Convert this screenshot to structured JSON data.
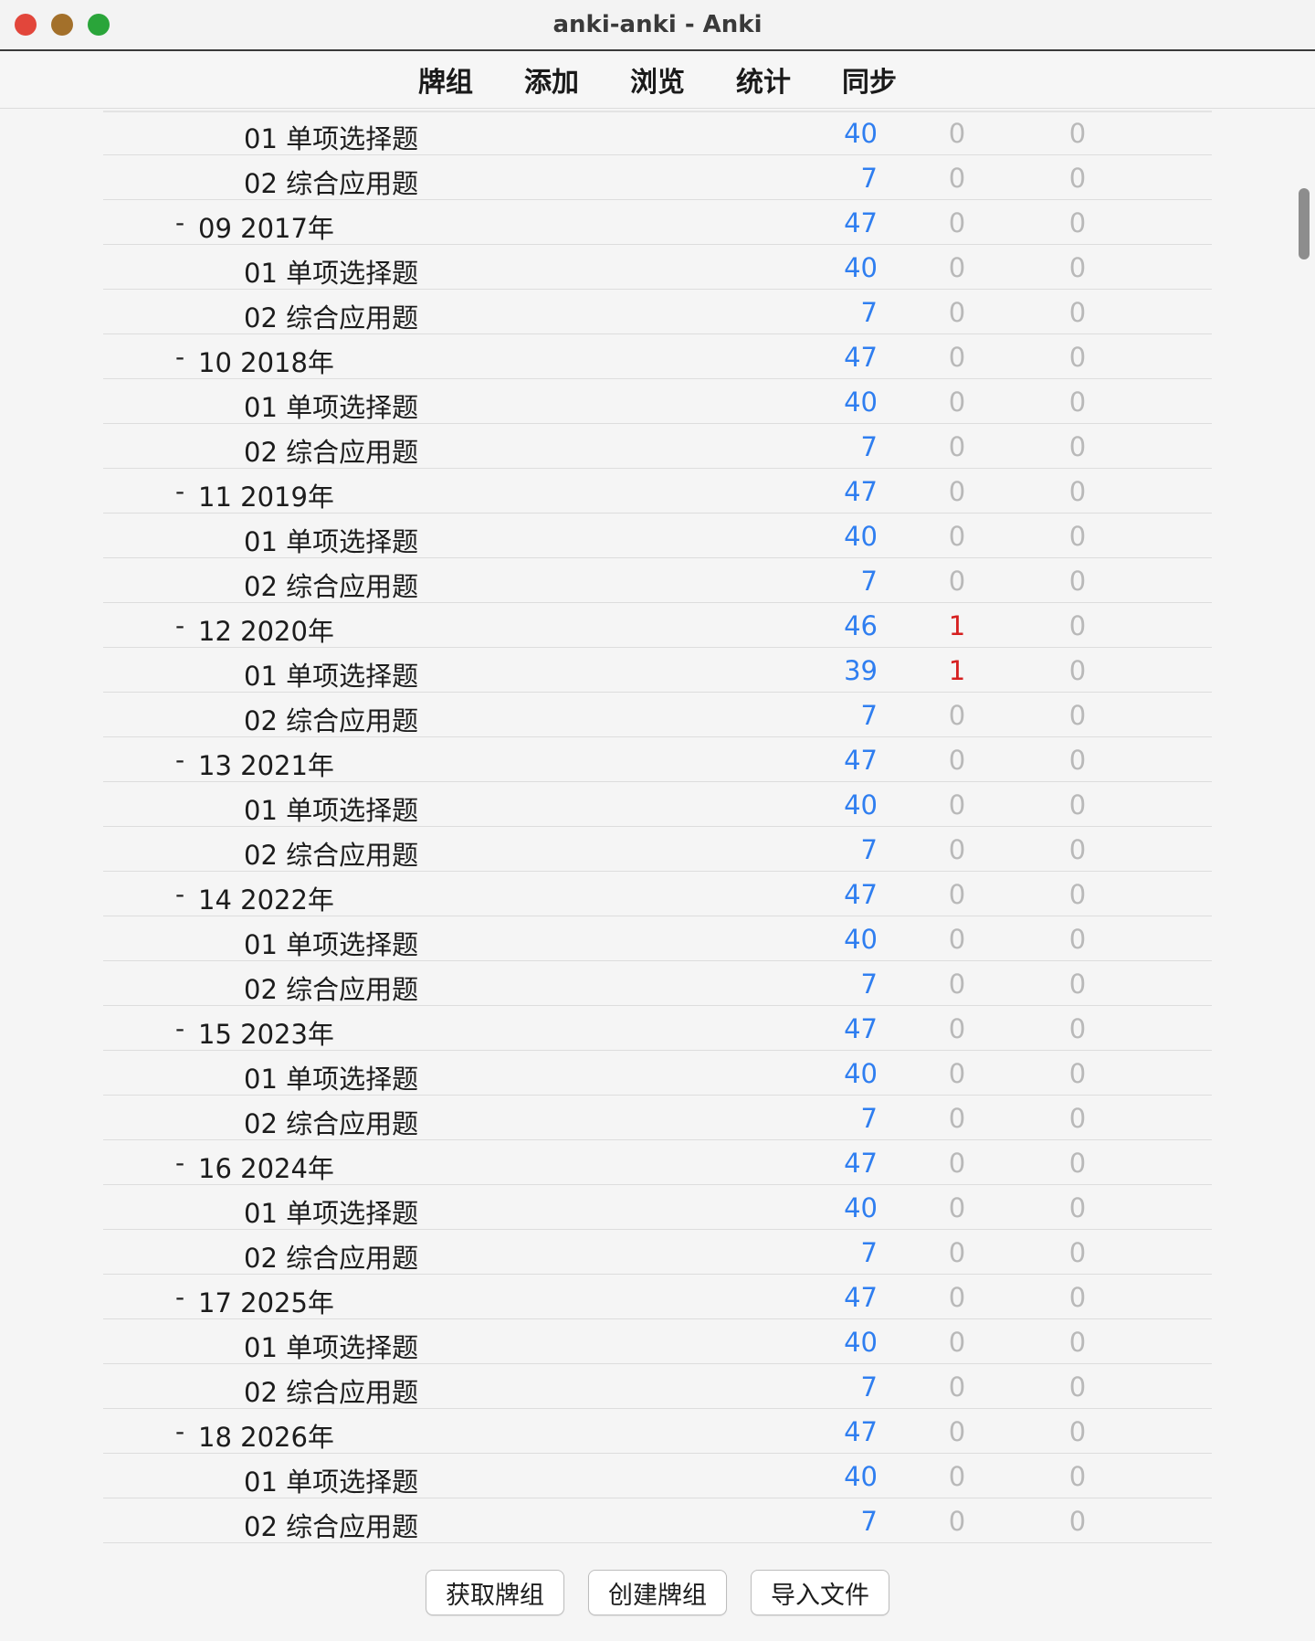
{
  "window": {
    "title": "anki-anki - Anki"
  },
  "toolbar": {
    "tabs": [
      "牌组",
      "添加",
      "浏览",
      "统计",
      "同步"
    ]
  },
  "decks": [
    {
      "level": "child",
      "toggle": "",
      "name": "01 单项选择题",
      "new": "40",
      "learn": "0",
      "review": "0"
    },
    {
      "level": "child",
      "toggle": "",
      "name": "02 综合应用题",
      "new": "7",
      "learn": "0",
      "review": "0"
    },
    {
      "level": "parent",
      "toggle": "-",
      "name": "09 2017年",
      "new": "47",
      "learn": "0",
      "review": "0"
    },
    {
      "level": "child",
      "toggle": "",
      "name": "01 单项选择题",
      "new": "40",
      "learn": "0",
      "review": "0"
    },
    {
      "level": "child",
      "toggle": "",
      "name": "02 综合应用题",
      "new": "7",
      "learn": "0",
      "review": "0"
    },
    {
      "level": "parent",
      "toggle": "-",
      "name": "10 2018年",
      "new": "47",
      "learn": "0",
      "review": "0"
    },
    {
      "level": "child",
      "toggle": "",
      "name": "01 单项选择题",
      "new": "40",
      "learn": "0",
      "review": "0"
    },
    {
      "level": "child",
      "toggle": "",
      "name": "02 综合应用题",
      "new": "7",
      "learn": "0",
      "review": "0"
    },
    {
      "level": "parent",
      "toggle": "-",
      "name": "11 2019年",
      "new": "47",
      "learn": "0",
      "review": "0"
    },
    {
      "level": "child",
      "toggle": "",
      "name": "01 单项选择题",
      "new": "40",
      "learn": "0",
      "review": "0"
    },
    {
      "level": "child",
      "toggle": "",
      "name": "02 综合应用题",
      "new": "7",
      "learn": "0",
      "review": "0"
    },
    {
      "level": "parent",
      "toggle": "-",
      "name": "12 2020年",
      "new": "46",
      "learn": "1",
      "review": "0"
    },
    {
      "level": "child",
      "toggle": "",
      "name": "01 单项选择题",
      "new": "39",
      "learn": "1",
      "review": "0"
    },
    {
      "level": "child",
      "toggle": "",
      "name": "02 综合应用题",
      "new": "7",
      "learn": "0",
      "review": "0"
    },
    {
      "level": "parent",
      "toggle": "-",
      "name": "13 2021年",
      "new": "47",
      "learn": "0",
      "review": "0"
    },
    {
      "level": "child",
      "toggle": "",
      "name": "01 单项选择题",
      "new": "40",
      "learn": "0",
      "review": "0"
    },
    {
      "level": "child",
      "toggle": "",
      "name": "02 综合应用题",
      "new": "7",
      "learn": "0",
      "review": "0"
    },
    {
      "level": "parent",
      "toggle": "-",
      "name": "14 2022年",
      "new": "47",
      "learn": "0",
      "review": "0"
    },
    {
      "level": "child",
      "toggle": "",
      "name": "01 单项选择题",
      "new": "40",
      "learn": "0",
      "review": "0"
    },
    {
      "level": "child",
      "toggle": "",
      "name": "02 综合应用题",
      "new": "7",
      "learn": "0",
      "review": "0"
    },
    {
      "level": "parent",
      "toggle": "-",
      "name": "15 2023年",
      "new": "47",
      "learn": "0",
      "review": "0"
    },
    {
      "level": "child",
      "toggle": "",
      "name": "01 单项选择题",
      "new": "40",
      "learn": "0",
      "review": "0"
    },
    {
      "level": "child",
      "toggle": "",
      "name": "02 综合应用题",
      "new": "7",
      "learn": "0",
      "review": "0"
    },
    {
      "level": "parent",
      "toggle": "-",
      "name": "16 2024年",
      "new": "47",
      "learn": "0",
      "review": "0"
    },
    {
      "level": "child",
      "toggle": "",
      "name": "01 单项选择题",
      "new": "40",
      "learn": "0",
      "review": "0"
    },
    {
      "level": "child",
      "toggle": "",
      "name": "02 综合应用题",
      "new": "7",
      "learn": "0",
      "review": "0"
    },
    {
      "level": "parent",
      "toggle": "-",
      "name": "17 2025年",
      "new": "47",
      "learn": "0",
      "review": "0"
    },
    {
      "level": "child",
      "toggle": "",
      "name": "01 单项选择题",
      "new": "40",
      "learn": "0",
      "review": "0"
    },
    {
      "level": "child",
      "toggle": "",
      "name": "02 综合应用题",
      "new": "7",
      "learn": "0",
      "review": "0"
    },
    {
      "level": "parent",
      "toggle": "-",
      "name": "18 2026年",
      "new": "47",
      "learn": "0",
      "review": "0"
    },
    {
      "level": "child",
      "toggle": "",
      "name": "01 单项选择题",
      "new": "40",
      "learn": "0",
      "review": "0"
    },
    {
      "level": "child",
      "toggle": "",
      "name": "02 综合应用题",
      "new": "7",
      "learn": "0",
      "review": "0"
    }
  ],
  "colors": {
    "new": "#2f7ef0",
    "learn_active": "#d62020",
    "zero": "#b9b9b9"
  },
  "buttons": {
    "get_shared": "获取牌组",
    "create_deck": "创建牌组",
    "import_file": "导入文件"
  }
}
